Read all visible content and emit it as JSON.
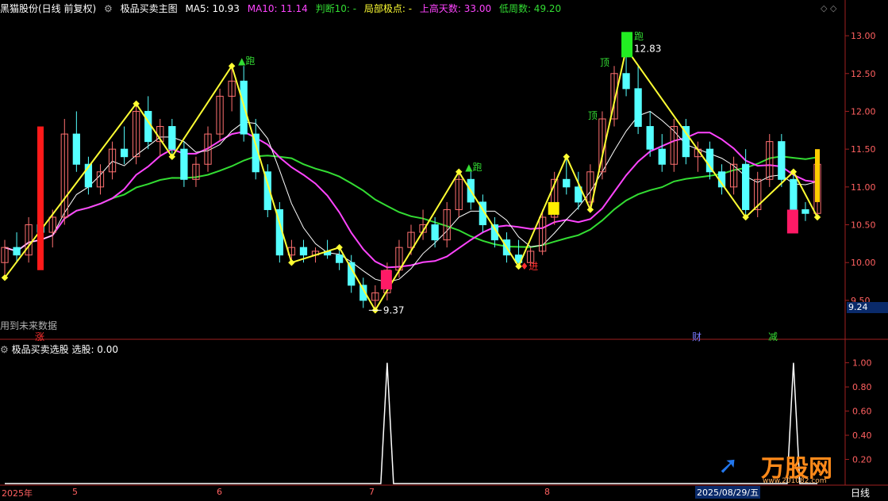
{
  "main_header": {
    "stock": "黑猫股份(日线 前复权)",
    "indicator": "极品买卖主图",
    "ma5": "MA5: 10.93",
    "ma10": "MA10: 11.14",
    "judge": "判断10: -",
    "local_extreme": "局部极点: -",
    "rise_days": "上高天数: 33.00",
    "low_weeks": "低周数: 49.20"
  },
  "future_note": "用到未来数据",
  "sub_header": {
    "indicator": "极品买卖选股",
    "value": "选股: 0.00"
  },
  "markers": {
    "zhang": "涨",
    "cai": "财",
    "jian": "减",
    "pao": "跑",
    "ding": "顶",
    "jin": "进"
  },
  "price_labels": {
    "high": "12.83",
    "low": "9.37"
  },
  "current_price": "9.24",
  "bottom_axis": {
    "months": [
      "2025年",
      "5",
      "6",
      "7",
      "8"
    ],
    "date_label": "2025/08/29/五",
    "period": "日线"
  },
  "brand": {
    "name": "万股网",
    "url": "www.201082.com"
  },
  "colors": {
    "up": "#ff7070",
    "down": "#54ffff",
    "ma5": "#ffffff",
    "ma10": "#ffff00",
    "ma_green": "#33dd33",
    "ma_magenta": "#ff44ff",
    "zigzag": "#ffff33"
  },
  "chart_data": [
    {
      "type": "candlestick",
      "title": "极品买卖主图",
      "ylim": [
        9.3,
        13.2
      ],
      "yticks": [
        9.5,
        10.0,
        10.5,
        11.0,
        11.5,
        12.0,
        12.5,
        13.0
      ],
      "ohlc": [
        [
          10.0,
          10.3,
          9.8,
          10.2
        ],
        [
          10.2,
          10.4,
          10.0,
          10.1
        ],
        [
          10.1,
          10.6,
          10.0,
          10.5
        ],
        [
          10.5,
          10.8,
          10.3,
          10.4
        ],
        [
          10.4,
          10.7,
          10.2,
          10.6
        ],
        [
          10.6,
          11.9,
          10.5,
          11.7
        ],
        [
          11.7,
          12.0,
          11.2,
          11.3
        ],
        [
          11.3,
          11.4,
          10.9,
          11.0
        ],
        [
          11.0,
          11.3,
          10.9,
          11.2
        ],
        [
          11.2,
          11.6,
          11.1,
          11.5
        ],
        [
          11.5,
          11.8,
          11.3,
          11.4
        ],
        [
          11.4,
          12.1,
          11.3,
          12.0
        ],
        [
          12.0,
          12.2,
          11.5,
          11.6
        ],
        [
          11.6,
          11.9,
          11.4,
          11.8
        ],
        [
          11.8,
          11.9,
          11.4,
          11.5
        ],
        [
          11.5,
          11.6,
          11.0,
          11.1
        ],
        [
          11.1,
          11.4,
          11.0,
          11.3
        ],
        [
          11.3,
          11.8,
          11.2,
          11.7
        ],
        [
          11.7,
          12.3,
          11.6,
          12.2
        ],
        [
          12.2,
          12.6,
          12.0,
          12.4
        ],
        [
          12.4,
          12.6,
          11.6,
          11.7
        ],
        [
          11.7,
          11.9,
          11.1,
          11.2
        ],
        [
          11.2,
          11.3,
          10.6,
          10.7
        ],
        [
          10.7,
          10.8,
          10.0,
          10.1
        ],
        [
          10.1,
          10.3,
          10.0,
          10.2
        ],
        [
          10.2,
          10.3,
          10.0,
          10.1
        ],
        [
          10.1,
          10.2,
          10.0,
          10.15
        ],
        [
          10.15,
          10.3,
          10.05,
          10.1
        ],
        [
          10.1,
          10.2,
          9.9,
          10.0
        ],
        [
          10.0,
          10.1,
          9.6,
          9.7
        ],
        [
          9.7,
          9.8,
          9.4,
          9.5
        ],
        [
          9.5,
          9.7,
          9.37,
          9.6
        ],
        [
          9.6,
          10.0,
          9.5,
          9.9
        ],
        [
          9.9,
          10.3,
          9.8,
          10.2
        ],
        [
          10.2,
          10.5,
          10.1,
          10.4
        ],
        [
          10.4,
          10.7,
          10.3,
          10.5
        ],
        [
          10.5,
          10.6,
          10.2,
          10.3
        ],
        [
          10.3,
          10.8,
          10.2,
          10.7
        ],
        [
          10.7,
          11.2,
          10.6,
          11.1
        ],
        [
          11.1,
          11.2,
          10.7,
          10.8
        ],
        [
          10.8,
          10.9,
          10.4,
          10.5
        ],
        [
          10.5,
          10.6,
          10.2,
          10.3
        ],
        [
          10.3,
          10.4,
          10.0,
          10.1
        ],
        [
          10.1,
          10.3,
          9.95,
          10.0
        ],
        [
          10.0,
          10.2,
          9.95,
          10.15
        ],
        [
          10.15,
          10.7,
          10.1,
          10.6
        ],
        [
          10.6,
          11.2,
          10.5,
          11.1
        ],
        [
          11.1,
          11.4,
          10.9,
          11.0
        ],
        [
          11.0,
          11.2,
          10.7,
          10.8
        ],
        [
          10.8,
          11.3,
          10.7,
          11.2
        ],
        [
          11.2,
          12.0,
          11.1,
          11.9
        ],
        [
          11.9,
          12.6,
          11.8,
          12.5
        ],
        [
          12.5,
          12.83,
          12.2,
          12.3
        ],
        [
          12.3,
          12.6,
          11.7,
          11.8
        ],
        [
          11.8,
          12.0,
          11.4,
          11.5
        ],
        [
          11.5,
          11.7,
          11.2,
          11.3
        ],
        [
          11.3,
          11.9,
          11.2,
          11.8
        ],
        [
          11.8,
          11.9,
          11.3,
          11.4
        ],
        [
          11.4,
          11.6,
          11.2,
          11.5
        ],
        [
          11.5,
          11.6,
          11.1,
          11.2
        ],
        [
          11.2,
          11.3,
          10.9,
          11.0
        ],
        [
          11.0,
          11.4,
          10.9,
          11.3
        ],
        [
          11.3,
          11.5,
          10.6,
          10.7
        ],
        [
          10.7,
          11.2,
          10.6,
          11.1
        ],
        [
          11.1,
          11.7,
          11.0,
          11.6
        ],
        [
          11.6,
          11.7,
          11.0,
          11.1
        ],
        [
          11.1,
          11.2,
          10.6,
          10.7
        ],
        [
          10.7,
          10.8,
          10.55,
          10.65
        ],
        [
          10.65,
          11.4,
          10.6,
          11.3
        ]
      ]
    },
    {
      "type": "line",
      "title": "极品买卖选股",
      "ylim": [
        0,
        1.05
      ],
      "yticks": [
        0.2,
        0.4,
        0.6,
        0.8,
        1.0
      ],
      "spike_indices": [
        32,
        66
      ],
      "bar_count": 69
    }
  ]
}
